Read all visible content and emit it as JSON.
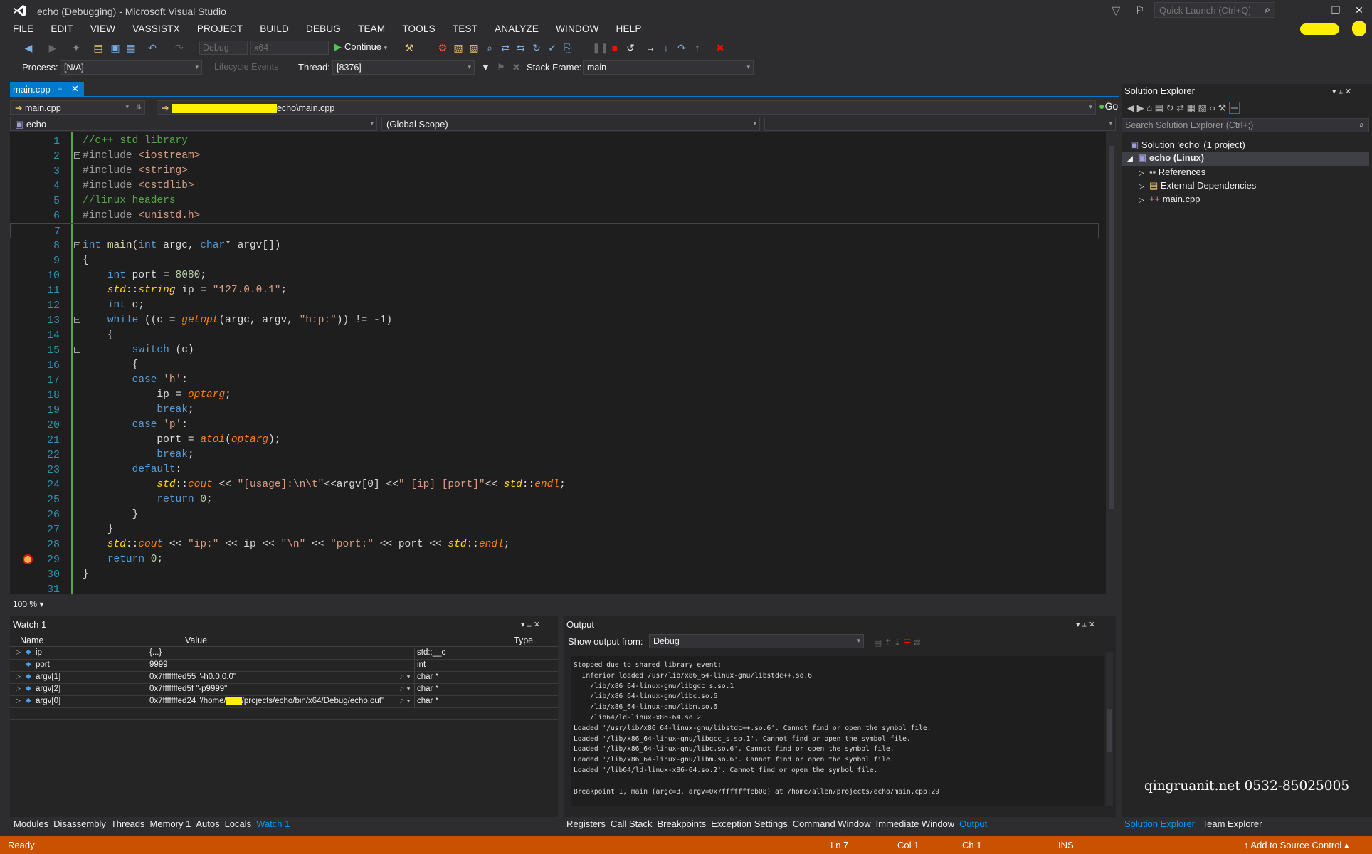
{
  "window": {
    "title": "echo (Debugging) - Microsoft Visual Studio",
    "quick_launch_placeholder": "Quick Launch (Ctrl+Q)"
  },
  "menu": [
    "FILE",
    "EDIT",
    "VIEW",
    "VASSISTX",
    "PROJECT",
    "BUILD",
    "DEBUG",
    "TEAM",
    "TOOLS",
    "TEST",
    "ANALYZE",
    "WINDOW",
    "HELP"
  ],
  "toolbar": {
    "config": "Debug",
    "platform": "x64",
    "continue_label": "Continue"
  },
  "debug_location": {
    "process_label": "Process:",
    "process_value": "[N/A]",
    "lifecycle_label": "Lifecycle Events",
    "thread_label": "Thread:",
    "thread_value": "[8376]",
    "stack_label": "Stack Frame:",
    "stack_value": "main"
  },
  "editor": {
    "tab": "main.cpp",
    "nav_file": "main.cpp",
    "nav_path_suffix": "echo\\main.cpp",
    "go_label": "Go",
    "project_scope": "echo",
    "global_scope": "(Global Scope)",
    "zoom": "100 %",
    "lines": [
      {
        "n": "1",
        "t": [
          [
            "cm",
            "//c++ std library"
          ]
        ]
      },
      {
        "n": "2",
        "t": [
          [
            "pp",
            "#include "
          ],
          [
            "st",
            "<iostream>"
          ]
        ]
      },
      {
        "n": "3",
        "t": [
          [
            "pp",
            "#include "
          ],
          [
            "st",
            "<string>"
          ]
        ]
      },
      {
        "n": "4",
        "t": [
          [
            "pp",
            "#include "
          ],
          [
            "st",
            "<cstdlib>"
          ]
        ]
      },
      {
        "n": "5",
        "t": [
          [
            "cm",
            "//linux headers"
          ]
        ]
      },
      {
        "n": "6",
        "t": [
          [
            "pp",
            "#include "
          ],
          [
            "st",
            "<unistd.h>"
          ]
        ]
      },
      {
        "n": "7",
        "t": []
      },
      {
        "n": "8",
        "t": [
          [
            "kw",
            "int"
          ],
          [
            "id",
            " "
          ],
          [
            "fn",
            "main"
          ],
          [
            "id",
            "("
          ],
          [
            "kw",
            "int"
          ],
          [
            "id",
            " argc, "
          ],
          [
            "kw",
            "char"
          ],
          [
            "id",
            "* argv[])"
          ]
        ]
      },
      {
        "n": "9",
        "t": [
          [
            "id",
            "{"
          ]
        ]
      },
      {
        "n": "10",
        "t": [
          [
            "id",
            "    "
          ],
          [
            "kw",
            "int"
          ],
          [
            "id",
            " port = "
          ],
          [
            "nm",
            "8080"
          ],
          [
            "id",
            ";"
          ]
        ]
      },
      {
        "n": "11",
        "t": [
          [
            "id",
            "    "
          ],
          [
            "ns",
            "std"
          ],
          [
            "id",
            "::"
          ],
          [
            "ns",
            "string"
          ],
          [
            "id",
            " ip = "
          ],
          [
            "st",
            "\"127.0.0.1\""
          ],
          [
            "id",
            ";"
          ]
        ]
      },
      {
        "n": "12",
        "t": [
          [
            "id",
            "    "
          ],
          [
            "kw",
            "int"
          ],
          [
            "id",
            " c;"
          ]
        ]
      },
      {
        "n": "13",
        "t": [
          [
            "id",
            "    "
          ],
          [
            "kw",
            "while"
          ],
          [
            "id",
            " ((c = "
          ],
          [
            "it",
            "getopt"
          ],
          [
            "id",
            "(argc, argv, "
          ],
          [
            "st",
            "\"h:p:\""
          ],
          [
            "id",
            ")) != -1)"
          ]
        ]
      },
      {
        "n": "14",
        "t": [
          [
            "id",
            "    {"
          ]
        ]
      },
      {
        "n": "15",
        "t": [
          [
            "id",
            "        "
          ],
          [
            "kw",
            "switch"
          ],
          [
            "id",
            " (c)"
          ]
        ]
      },
      {
        "n": "16",
        "t": [
          [
            "id",
            "        {"
          ]
        ]
      },
      {
        "n": "17",
        "t": [
          [
            "id",
            "        "
          ],
          [
            "kw",
            "case"
          ],
          [
            "id",
            " "
          ],
          [
            "st",
            "'h'"
          ],
          [
            "id",
            ":"
          ]
        ]
      },
      {
        "n": "18",
        "t": [
          [
            "id",
            "            ip = "
          ],
          [
            "it",
            "optarg"
          ],
          [
            "id",
            ";"
          ]
        ]
      },
      {
        "n": "19",
        "t": [
          [
            "id",
            "            "
          ],
          [
            "kw",
            "break"
          ],
          [
            "id",
            ";"
          ]
        ]
      },
      {
        "n": "20",
        "t": [
          [
            "id",
            "        "
          ],
          [
            "kw",
            "case"
          ],
          [
            "id",
            " "
          ],
          [
            "st",
            "'p'"
          ],
          [
            "id",
            ":"
          ]
        ]
      },
      {
        "n": "21",
        "t": [
          [
            "id",
            "            port = "
          ],
          [
            "it",
            "atoi"
          ],
          [
            "id",
            "("
          ],
          [
            "it",
            "optarg"
          ],
          [
            "id",
            ");"
          ]
        ]
      },
      {
        "n": "22",
        "t": [
          [
            "id",
            "            "
          ],
          [
            "kw",
            "break"
          ],
          [
            "id",
            ";"
          ]
        ]
      },
      {
        "n": "23",
        "t": [
          [
            "id",
            "        "
          ],
          [
            "kw",
            "default"
          ],
          [
            "id",
            ":"
          ]
        ]
      },
      {
        "n": "24",
        "t": [
          [
            "id",
            "            "
          ],
          [
            "ns",
            "std"
          ],
          [
            "id",
            "::"
          ],
          [
            "it",
            "cout"
          ],
          [
            "id",
            " << "
          ],
          [
            "st",
            "\"[usage]:\\n\\t\""
          ],
          [
            "id",
            "<<argv[0] <<"
          ],
          [
            "st",
            "\" [ip] [port]\""
          ],
          [
            "id",
            "<< "
          ],
          [
            "ns",
            "std"
          ],
          [
            "id",
            "::"
          ],
          [
            "it",
            "endl"
          ],
          [
            "id",
            ";"
          ]
        ]
      },
      {
        "n": "25",
        "t": [
          [
            "id",
            "            "
          ],
          [
            "kw",
            "return"
          ],
          [
            "id",
            " "
          ],
          [
            "nm",
            "0"
          ],
          [
            "id",
            ";"
          ]
        ]
      },
      {
        "n": "26",
        "t": [
          [
            "id",
            "        }"
          ]
        ]
      },
      {
        "n": "27",
        "t": [
          [
            "id",
            "    }"
          ]
        ]
      },
      {
        "n": "28",
        "t": [
          [
            "id",
            "    "
          ],
          [
            "ns",
            "std"
          ],
          [
            "id",
            "::"
          ],
          [
            "it",
            "cout"
          ],
          [
            "id",
            " << "
          ],
          [
            "st",
            "\"ip:\""
          ],
          [
            "id",
            " << ip << "
          ],
          [
            "st",
            "\"\\n\""
          ],
          [
            "id",
            " << "
          ],
          [
            "st",
            "\"port:\""
          ],
          [
            "id",
            " << port << "
          ],
          [
            "ns",
            "std"
          ],
          [
            "id",
            "::"
          ],
          [
            "it",
            "endl"
          ],
          [
            "id",
            ";"
          ]
        ]
      },
      {
        "n": "29",
        "t": [
          [
            "id",
            "    "
          ],
          [
            "kw",
            "return"
          ],
          [
            "id",
            " "
          ],
          [
            "nm",
            "0"
          ],
          [
            "id",
            ";"
          ]
        ]
      },
      {
        "n": "30",
        "t": [
          [
            "id",
            "}"
          ]
        ]
      },
      {
        "n": "31",
        "t": []
      }
    ]
  },
  "watch": {
    "title": "Watch 1",
    "headers": [
      "Name",
      "Value",
      "Type"
    ],
    "rows": [
      {
        "name": "ip",
        "value": "{...}",
        "type": "std::__cx"
      },
      {
        "name": "port",
        "value": "9999",
        "type": "int"
      },
      {
        "name": "argv[1]",
        "value": "0x7fffffffed55 \"-h0.0.0.0\"",
        "type": "char *"
      },
      {
        "name": "argv[2]",
        "value": "0x7fffffffed5f \"-p9999\"",
        "type": "char *"
      },
      {
        "name": "argv[0]",
        "value_prefix": "0x7fffffffed24 \"/home/",
        "value_suffix": "/projects/echo/bin/x64/Debug/echo.out\"",
        "type": "char *"
      }
    ]
  },
  "output": {
    "title": "Output",
    "show_from_label": "Show output from:",
    "source": "Debug",
    "lines": [
      "Stopped due to shared library event:",
      "  Inferior loaded /usr/lib/x86_64-linux-gnu/libstdc++.so.6",
      "    /lib/x86_64-linux-gnu/libgcc_s.so.1",
      "    /lib/x86_64-linux-gnu/libc.so.6",
      "    /lib/x86_64-linux-gnu/libm.so.6",
      "    /lib64/ld-linux-x86-64.so.2",
      "Loaded '/usr/lib/x86_64-linux-gnu/libstdc++.so.6'. Cannot find or open the symbol file.",
      "Loaded '/lib/x86_64-linux-gnu/libgcc_s.so.1'. Cannot find or open the symbol file.",
      "Loaded '/lib/x86_64-linux-gnu/libc.so.6'. Cannot find or open the symbol file.",
      "Loaded '/lib/x86_64-linux-gnu/libm.so.6'. Cannot find or open the symbol file.",
      "Loaded '/lib64/ld-linux-x86-64.so.2'. Cannot find or open the symbol file.",
      "",
      "Breakpoint 1, main (argc=3, argv=0x7fffffffeb08) at /home/allen/projects/echo/main.cpp:29"
    ]
  },
  "left_bottom_tabs": [
    "Modules",
    "Disassembly",
    "Threads",
    "Memory 1",
    "Autos",
    "Locals",
    "Watch 1"
  ],
  "right_bottom_tabs": [
    "Registers",
    "Call Stack",
    "Breakpoints",
    "Exception Settings",
    "Command Window",
    "Immediate Window",
    "Output"
  ],
  "solution_explorer": {
    "title": "Solution Explorer",
    "search_placeholder": "Search Solution Explorer (Ctrl+;)",
    "solution": "Solution 'echo' (1 project)",
    "project": "echo (Linux)",
    "items": [
      "References",
      "External Dependencies",
      "main.cpp"
    ],
    "tabs": [
      "Solution Explorer",
      "Team Explorer"
    ]
  },
  "watermark": "qingruanit.net 0532-85025005",
  "status": {
    "ready": "Ready",
    "ln": "Ln 7",
    "col": "Col 1",
    "ch": "Ch 1",
    "ins": "INS",
    "source_control": "Add to Source Control"
  },
  "colors": {
    "accent": "#007acc",
    "status_bar": "#ca5100",
    "background": "#2d2d30",
    "editor_bg": "#1e1e1e"
  }
}
